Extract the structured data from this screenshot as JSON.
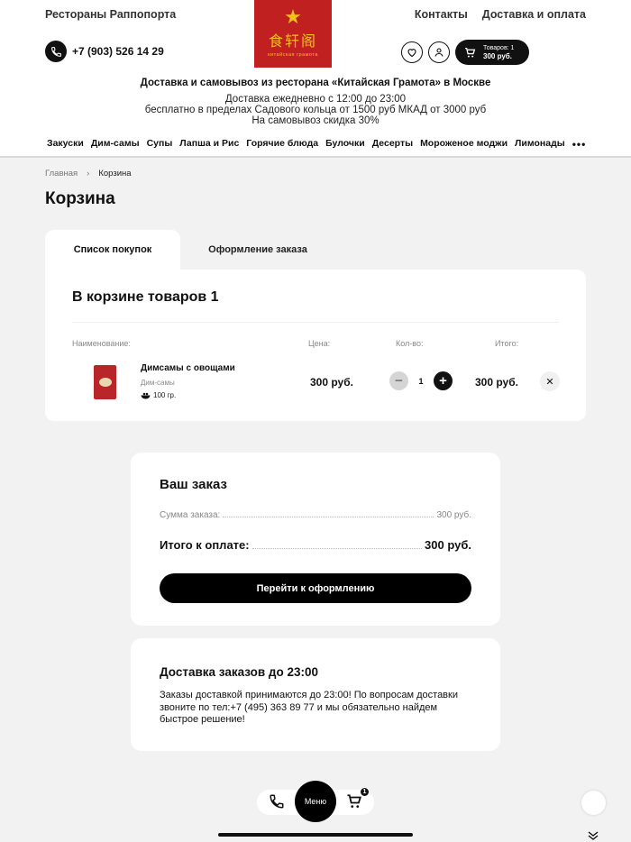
{
  "header": {
    "brand": "Рестораны Раппопорта",
    "links": [
      "Контакты",
      "Доставка и оплата"
    ],
    "phone": "+7 (903) 526 14 29",
    "logo": {
      "hanzi": "食轩阁",
      "subtitle": "китайская грамота"
    },
    "cart": {
      "label": "Товаров: 1",
      "sum": "300 руб."
    },
    "tagline": "Доставка и самовывоз из ресторана «Китайская Грамота» в Москве",
    "info": [
      "Доставка ежедневно с 12:00 до 23:00",
      "бесплатно в пределах Садового кольца от 1500 руб МКАД от 3000 руб",
      "На самовывоз скидка 30%"
    ],
    "nav": [
      "Закуски",
      "Дим-самы",
      "Супы",
      "Лапша и Рис",
      "Горячие блюда",
      "Булочки",
      "Десерты",
      "Мороженое моджи",
      "Лимонады"
    ],
    "accent": "#c0201f",
    "logo_text_color": "#f3c01c"
  },
  "breadcrumb": {
    "home": "Главная",
    "current": "Корзина"
  },
  "page_title": "Корзина",
  "tabs": [
    "Список покупок",
    "Оформление заказа"
  ],
  "cart": {
    "title": "В корзине товаров 1",
    "columns": {
      "name": "Наименование:",
      "price": "Цена:",
      "qty": "Кол-во:",
      "total": "Итого:"
    },
    "items": [
      {
        "name": "Димсамы с овощами",
        "category": "Дим-самы",
        "weight": "100 гр.",
        "price": "300 руб.",
        "qty": "1",
        "total": "300 руб."
      }
    ]
  },
  "order": {
    "title": "Ваш заказ",
    "sum_label": "Сумма заказа:",
    "sum_value": "300 руб.",
    "pay_label": "Итого к оплате:",
    "pay_value": "300 руб.",
    "button": "Перейти к оформлению"
  },
  "delivery": {
    "title": "Доставка заказов до 23:00",
    "text": "Заказы доставкой принимаются до 23:00! По вопросам доставки звоните по тел:+7 (495) 363 89 77 и мы обязательно найдем быстрое решение!"
  },
  "bottom": {
    "menu": "Меню",
    "cart_badge": "1"
  }
}
